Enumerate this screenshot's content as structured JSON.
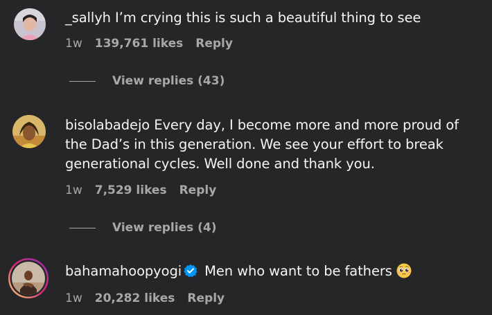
{
  "comments": [
    {
      "username": "_sallyh",
      "text": "I’m crying this is such a beautiful thing to see",
      "time": "1w",
      "likes": "139,761 likes",
      "reply_label": "Reply",
      "view_replies": "View replies (43)"
    },
    {
      "username": "bisolabadejo",
      "text": "Every day, I become more and more proud of the Dad’s in this generation. We see your effort to break generational cycles. Well done and thank you.",
      "time": "1w",
      "likes": "7,529 likes",
      "reply_label": "Reply",
      "view_replies": "View replies (4)"
    },
    {
      "username": "bahamahoopyogi",
      "verified": true,
      "text": "Men who want to be fathers",
      "emoji": "pleading-face-emoji",
      "time": "1w",
      "likes": "20,282 likes",
      "reply_label": "Reply"
    }
  ],
  "colors": {
    "background": "#262628",
    "primary_text": "#f5f5f5",
    "secondary_text": "#a8a8a8",
    "verified_blue": "#0095f6",
    "story_ring": [
      "#feda75",
      "#d62976",
      "#962fbf"
    ]
  }
}
